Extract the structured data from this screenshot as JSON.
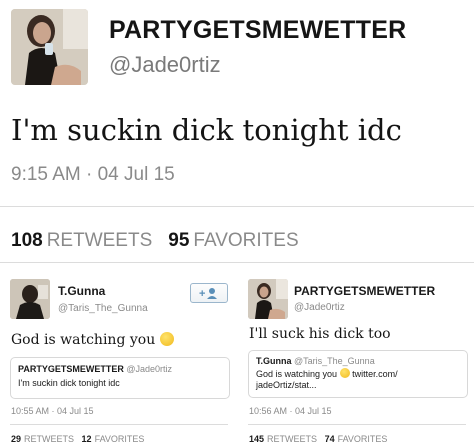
{
  "main_tweet": {
    "display_name": "PARTYGETSMEWETTER",
    "handle": "@Jade0rtiz",
    "text": "I'm suckin dick tonight idc",
    "timestamp": "9:15 AM · 04 Jul 15",
    "retweets_count": "108",
    "retweets_label": "RETWEETS",
    "favorites_count": "95",
    "favorites_label": "FAVORITES"
  },
  "reply_left": {
    "display_name": "T.Gunna",
    "handle": "@Taris_The_Gunna",
    "text": "God is watching you",
    "follow_icon": "add-user-icon",
    "quote": {
      "display_name": "PARTYGETSMEWETTER",
      "handle": "@Jade0rtiz",
      "text": "I'm suckin dick tonight idc"
    },
    "timestamp": "10:55 AM · 04 Jul 15",
    "retweets_count": "29",
    "retweets_label": "RETWEETS",
    "favorites_count": "12",
    "favorites_label": "FAVORITES"
  },
  "reply_right": {
    "display_name": "PARTYGETSMEWETTER",
    "handle": "@Jade0rtiz",
    "text": "I'll suck his dick too",
    "quote": {
      "display_name": "T.Gunna",
      "handle": "@Taris_The_Gunna",
      "line1_text": "God is watching you",
      "line1_link": "twitter.com/",
      "line2_text": "jadeOrtiz/stat..."
    },
    "timestamp": "10:56 AM · 04 Jul 15",
    "retweets_count": "145",
    "retweets_label": "RETWEETS",
    "favorites_count": "74",
    "favorites_label": "FAVORITES"
  },
  "colors": {
    "text_primary": "#151515",
    "text_secondary": "#8a8a8a",
    "divider": "#dcdcdc",
    "follow_accent": "#5a8fb8",
    "emoji": "#f0b91d"
  }
}
